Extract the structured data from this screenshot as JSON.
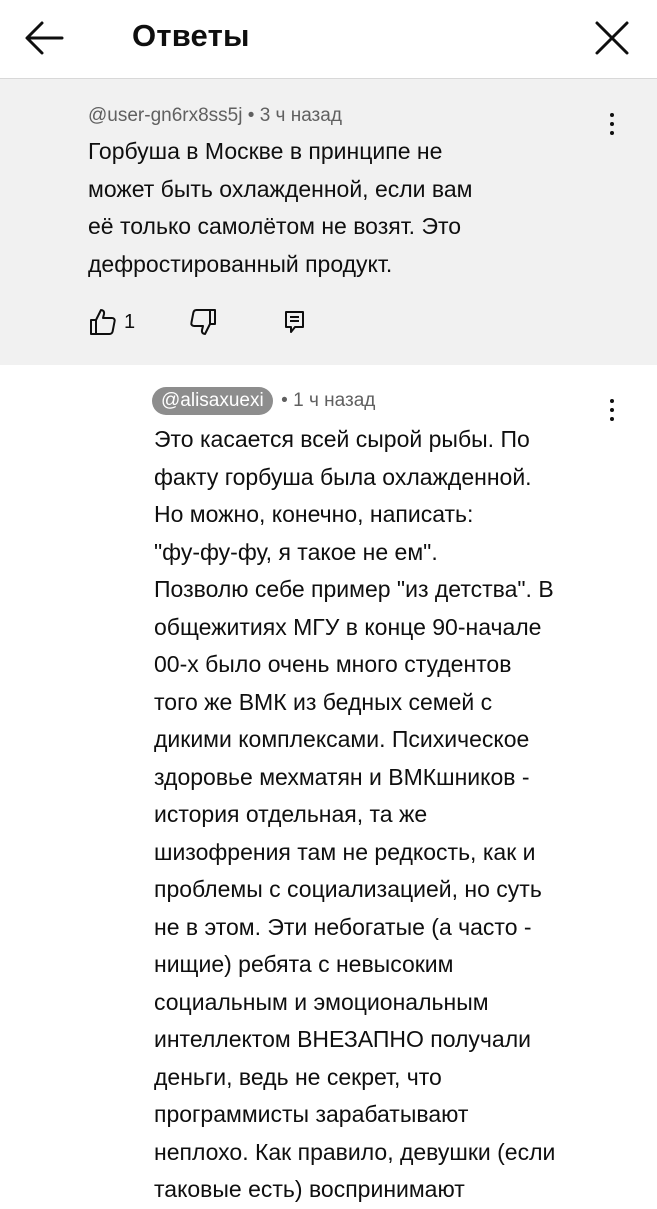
{
  "header": {
    "title": "Ответы",
    "back_icon": "arrow-left-icon",
    "close_icon": "close-icon"
  },
  "parent_comment": {
    "author": "@user-gn6rx8ss5j",
    "separator": "•",
    "time": "3 ч назад",
    "text": "Горбуша в Москве в принципе не\nможет быть охлажденной, если вам\nеё только самолётом не возят. Это\nдефростированный продукт.",
    "likes": "1",
    "like_icon": "thumb-up-icon",
    "dislike_icon": "thumb-down-icon",
    "reply_icon": "reply-icon",
    "menu_icon": "more-vert-icon"
  },
  "reply": {
    "author": "@alisaxuexi",
    "separator": "•",
    "time": "1 ч назад",
    "text": "Это касается всей сырой рыбы. По\nфакту горбуша была охлажденной.\nНо можно, конечно, написать:\n\"фу-фу-фу, я такое не ем\".\nПозволю себе пример \"из детства\". В\nобщежитиях МГУ в конце 90-начале\n00-х было очень много студентов\nтого же ВМК из бедных семей с\nдикими комплексами. Психическое\nздоровье мехматян и ВМКшников -\nистория отдельная, та же\nшизофрения там не редкость, как и\nпроблемы с социализацией, но суть\nне в этом. Эти небогатые (а часто -\nнищие) ребята с невысоким\nсоциальным и эмоциональным\nинтеллектом ВНЕЗАПНО получали\nденьги, ведь не секрет, что\nпрограммисты зарабатывают\nнеплохо. Как правило, девушки (если\nтаковые есть) воспринимают",
    "menu_icon": "more-vert-icon"
  },
  "colors": {
    "text": "#0f0f0f",
    "meta": "#606060",
    "parent_bg": "#f1f1f1",
    "chip_bg": "#8d8d8d"
  }
}
